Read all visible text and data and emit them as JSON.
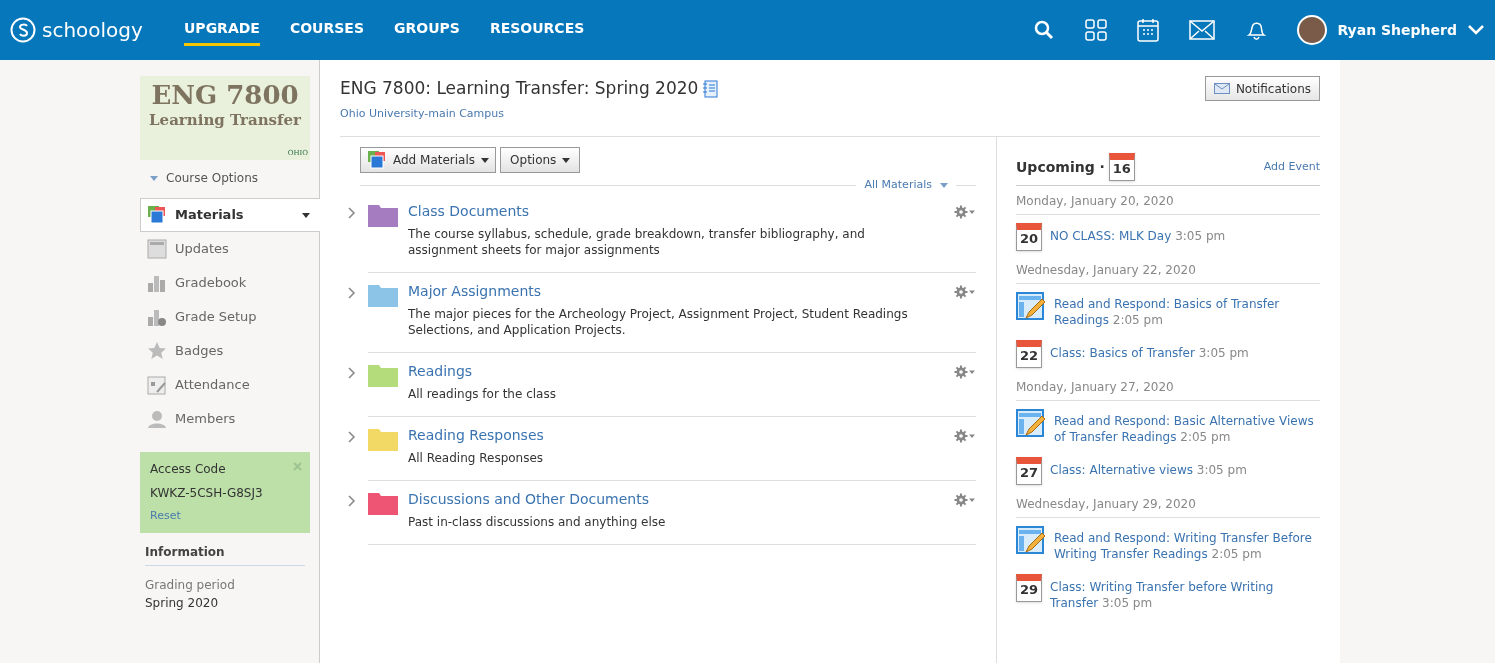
{
  "header": {
    "brand": "schoology",
    "nav": [
      {
        "label": "UPGRADE",
        "selected": true
      },
      {
        "label": "COURSES",
        "selected": false
      },
      {
        "label": "GROUPS",
        "selected": false
      },
      {
        "label": "RESOURCES",
        "selected": false
      }
    ],
    "user": "Ryan Shepherd"
  },
  "sidebar": {
    "course_image": {
      "line_1": "ENG 7800",
      "line_2": "Learning Transfer",
      "badge": "OHIO"
    },
    "course_options": "Course Options",
    "items": [
      {
        "label": "Materials",
        "selected": true,
        "kind": "materials"
      },
      {
        "label": "Updates",
        "selected": false,
        "kind": "updates"
      },
      {
        "label": "Gradebook",
        "selected": false,
        "kind": "gradebook"
      },
      {
        "label": "Grade Setup",
        "selected": false,
        "kind": "grade-setup"
      },
      {
        "label": "Badges",
        "selected": false,
        "kind": "badges"
      },
      {
        "label": "Attendance",
        "selected": false,
        "kind": "attendance"
      },
      {
        "label": "Members",
        "selected": false,
        "kind": "members"
      }
    ],
    "access_code": {
      "title": "Access Code",
      "code": "KWKZ-5CSH-G8SJ3",
      "reset": "Reset"
    },
    "information": {
      "title": "Information",
      "label": "Grading period",
      "value": "Spring 2020"
    }
  },
  "course": {
    "title": "ENG 7800: Learning Transfer: Spring 2020",
    "school": "Ohio University-main Campus",
    "notifications": "Notifications"
  },
  "materials": {
    "add": "Add Materials",
    "options": "Options",
    "filter": "All Materials",
    "folders": [
      {
        "title": "Class Documents",
        "description": "The course syllabus, schedule, grade breakdown, transfer bibliography, and assignment sheets for major assignments",
        "color": "#a57cc0"
      },
      {
        "title": "Major Assignments",
        "description": "The major pieces for the Archeology Project, Assignment Project, Student Readings Selections, and Application Projects.",
        "color": "#8cc4e8"
      },
      {
        "title": "Readings",
        "description": "All readings for the class",
        "color": "#b5dc7a"
      },
      {
        "title": "Reading Responses",
        "description": "All Reading Responses",
        "color": "#f2d865"
      },
      {
        "title": "Discussions and Other Documents",
        "description": "Past in-class discussions and anything else",
        "color": "#ee5574"
      }
    ]
  },
  "upcoming": {
    "title": "Upcoming ·",
    "icon_day": "16",
    "add_event": "Add Event",
    "days": [
      {
        "date": "Monday, January 20, 2020",
        "events": [
          {
            "kind": "calendar",
            "day": "20",
            "title": "NO CLASS: MLK Day",
            "time": "3:05 pm"
          }
        ]
      },
      {
        "date": "Wednesday, January 22, 2020",
        "events": [
          {
            "kind": "assignment",
            "title": "Read and Respond: Basics of Transfer Readings",
            "time": "2:05 pm"
          },
          {
            "kind": "calendar",
            "day": "22",
            "title": "Class: Basics of Transfer",
            "time": "3:05 pm"
          }
        ]
      },
      {
        "date": "Monday, January 27, 2020",
        "events": [
          {
            "kind": "assignment",
            "title": "Read and Respond: Basic Alternative Views of Transfer Readings",
            "time": "2:05 pm"
          },
          {
            "kind": "calendar",
            "day": "27",
            "title": "Class: Alternative views",
            "time": "3:05 pm"
          }
        ]
      },
      {
        "date": "Wednesday, January 29, 2020",
        "events": [
          {
            "kind": "assignment",
            "title": "Read and Respond: Writing Transfer Before Writing Transfer Readings",
            "time": "2:05 pm"
          },
          {
            "kind": "calendar",
            "day": "29",
            "title": "Class: Writing Transfer before Writing Transfer",
            "time": "3:05 pm"
          }
        ]
      }
    ]
  }
}
